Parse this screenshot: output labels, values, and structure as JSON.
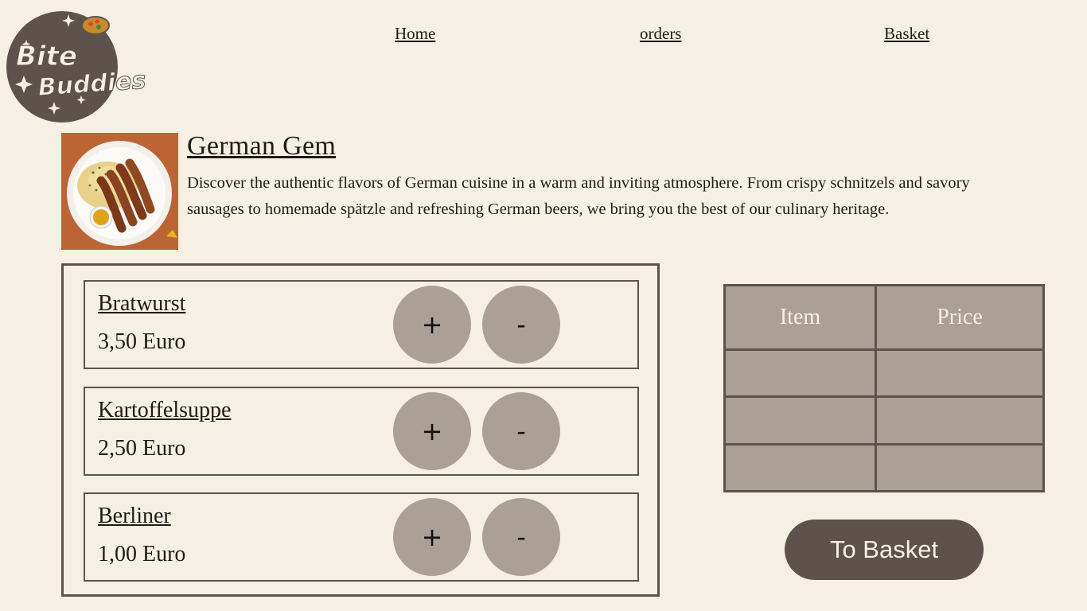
{
  "logo": {
    "line1": "Bite",
    "line2": "Buddies"
  },
  "nav": [
    {
      "label": "Home"
    },
    {
      "label": "orders"
    },
    {
      "label": "Basket"
    }
  ],
  "restaurant": {
    "name": "German Gem",
    "description": "Discover the authentic flavors of German cuisine in a warm and inviting atmosphere. From crispy schnitzels and savory sausages to homemade spätzle and refreshing German beers, we bring you the best of our culinary heritage."
  },
  "menu": [
    {
      "name": "Bratwurst",
      "price": "3,50 Euro",
      "add": "+",
      "remove": "-"
    },
    {
      "name": "Kartoffelsuppe",
      "price": "2,50 Euro",
      "add": "+",
      "remove": "-"
    },
    {
      "name": "Berliner",
      "price": "1,00 Euro",
      "add": "+",
      "remove": "-"
    }
  ],
  "basket": {
    "headers": [
      "Item",
      "Price"
    ],
    "rows": [
      [
        "",
        ""
      ],
      [
        "",
        ""
      ],
      [
        "",
        ""
      ]
    ]
  },
  "to_basket_label": "To Basket",
  "colors": {
    "background": "#f6f0e4",
    "accent_dark": "#5d534c",
    "accent_light": "#aba094"
  }
}
